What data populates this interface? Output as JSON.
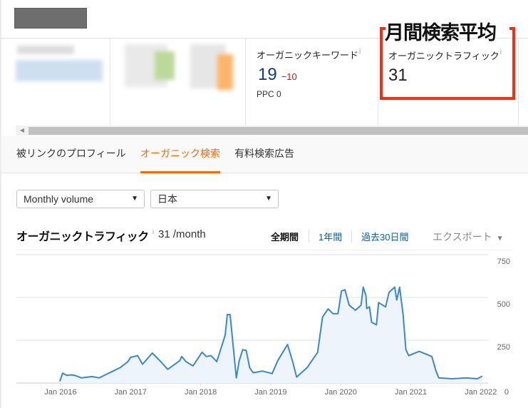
{
  "site_name": "",
  "annotation": {
    "title": "月間検索平均",
    "color": "#ff2a12"
  },
  "metrics": [
    {
      "label": "オーガニックキーワード",
      "info": "i",
      "value": "19",
      "delta": "−10",
      "sub": "PPC 0",
      "value_color": "#0f3b8c"
    },
    {
      "label": "オーガニックトラフィック",
      "info": "i",
      "value": "31"
    }
  ],
  "tabs": [
    {
      "label": "被リンクのプロフィール",
      "active": false
    },
    {
      "label": "オーガニック検索",
      "active": true
    },
    {
      "label": "有料検索広告",
      "active": false
    }
  ],
  "filters": {
    "volume_select": "Monthly volume",
    "country_select": "日本"
  },
  "chart_header": {
    "title": "オーガニックトラフィック",
    "info": "i",
    "value": "31 /month",
    "periods": [
      "全期間",
      "1年間",
      "過去30日間"
    ],
    "active_period": "全期間",
    "export_label": "エクスポート"
  },
  "colors": {
    "accent": "#ff6700",
    "line": "#3a87d6",
    "area": "#eef4fb",
    "link": "#0f5c9c"
  },
  "chart_data": {
    "type": "area",
    "title": "オーガニックトラフィック",
    "xlabel": "",
    "ylabel": "",
    "x_ticks": [
      "Jan 2016",
      "Jan 2017",
      "Jan 2018",
      "Jan 2019",
      "Jan 2020",
      "Jan 2021",
      "Jan 2022"
    ],
    "y_ticks": [
      0,
      250,
      500,
      750
    ],
    "ylim": [
      0,
      750
    ],
    "xlim": [
      2015.5,
      2022.2
    ],
    "grid": true,
    "y_axis_position": "right",
    "series": [
      {
        "name": "オーガニックトラフィック",
        "x": [
          2015.99,
          2016.03,
          2016.09,
          2016.15,
          2016.2,
          2016.3,
          2016.45,
          2016.55,
          2016.65,
          2016.75,
          2016.85,
          2016.96,
          2017.0,
          2017.1,
          2017.17,
          2017.31,
          2017.43,
          2017.53,
          2017.7,
          2017.73,
          2017.79,
          2017.89,
          2018.02,
          2018.08,
          2018.15,
          2018.23,
          2018.35,
          2018.38,
          2018.42,
          2018.48,
          2018.51,
          2018.55,
          2018.6,
          2018.65,
          2018.7,
          2018.75,
          2018.88,
          2019.02,
          2019.1,
          2019.24,
          2019.31,
          2019.37,
          2019.52,
          2019.67,
          2019.74,
          2019.82,
          2019.89,
          2019.96,
          2020.01,
          2020.06,
          2020.12,
          2020.21,
          2020.29,
          2020.32,
          2020.36,
          2020.37,
          2020.41,
          2020.44,
          2020.51,
          2020.54,
          2020.64,
          2020.69,
          2020.77,
          2020.8,
          2020.84,
          2020.89,
          2020.93,
          2020.97,
          2021.12,
          2021.3,
          2021.36,
          2021.4,
          2021.59,
          2021.79,
          2021.95,
          2022.02
        ],
        "values": [
          10,
          58,
          45,
          48,
          45,
          30,
          38,
          30,
          50,
          70,
          90,
          125,
          150,
          160,
          110,
          175,
          125,
          80,
          130,
          155,
          125,
          100,
          180,
          155,
          160,
          125,
          280,
          400,
          400,
          150,
          30,
          130,
          195,
          190,
          90,
          60,
          70,
          55,
          130,
          225,
          130,
          35,
          90,
          180,
          385,
          433,
          405,
          405,
          538,
          545,
          455,
          425,
          455,
          560,
          510,
          435,
          445,
          355,
          340,
          470,
          445,
          530,
          560,
          485,
          560,
          400,
          195,
          160,
          185,
          155,
          70,
          30,
          25,
          30,
          25,
          40
        ]
      }
    ]
  }
}
